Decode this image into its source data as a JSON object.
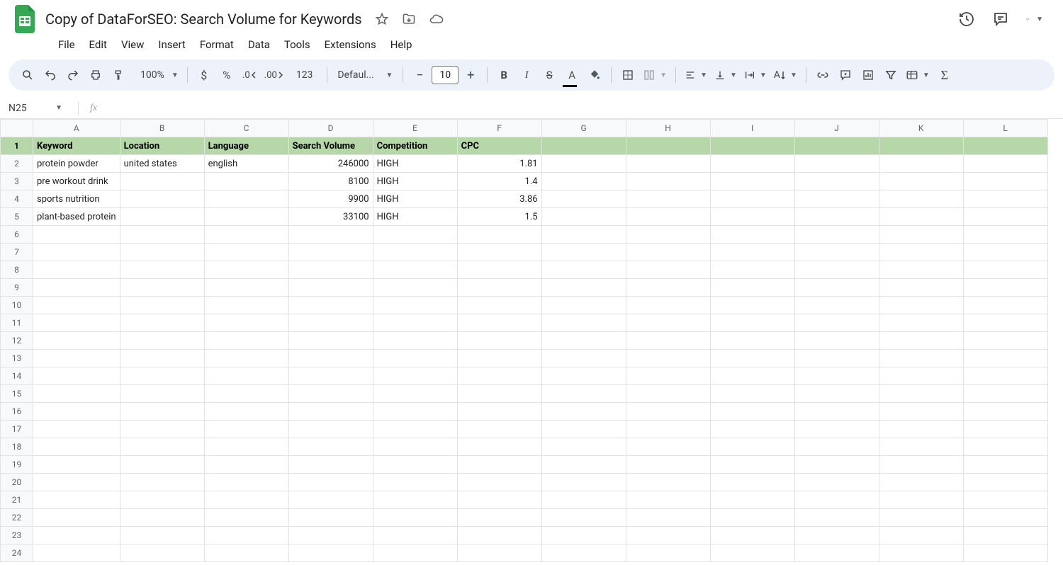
{
  "doc": {
    "title": "Copy of DataForSEO: Search Volume for Keywords"
  },
  "menu": [
    "File",
    "Edit",
    "View",
    "Insert",
    "Format",
    "Data",
    "Tools",
    "Extensions",
    "Help"
  ],
  "toolbar": {
    "zoom": "100%",
    "font_family": "Defaul...",
    "font_size": "10",
    "number_format_123": "123"
  },
  "namebox": {
    "cell": "N25",
    "formula": ""
  },
  "columns": [
    "A",
    "B",
    "C",
    "D",
    "E",
    "F",
    "G",
    "H",
    "I",
    "J",
    "K",
    "L"
  ],
  "headers": [
    "Keyword",
    "Location",
    "Language",
    "Search Volume",
    "Competition",
    "CPC"
  ],
  "data_rows": [
    {
      "keyword": "protein powder",
      "location": "united states",
      "language": "english",
      "search_volume": "246000",
      "competition": "HIGH",
      "cpc": "1.81"
    },
    {
      "keyword": "pre workout drink",
      "location": "",
      "language": "",
      "search_volume": "8100",
      "competition": "HIGH",
      "cpc": "1.4"
    },
    {
      "keyword": "sports nutrition",
      "location": "",
      "language": "",
      "search_volume": "9900",
      "competition": "HIGH",
      "cpc": "3.86"
    },
    {
      "keyword": "plant-based protein",
      "location": "",
      "language": "",
      "search_volume": "33100",
      "competition": "HIGH",
      "cpc": "1.5"
    }
  ],
  "total_rows": 24
}
